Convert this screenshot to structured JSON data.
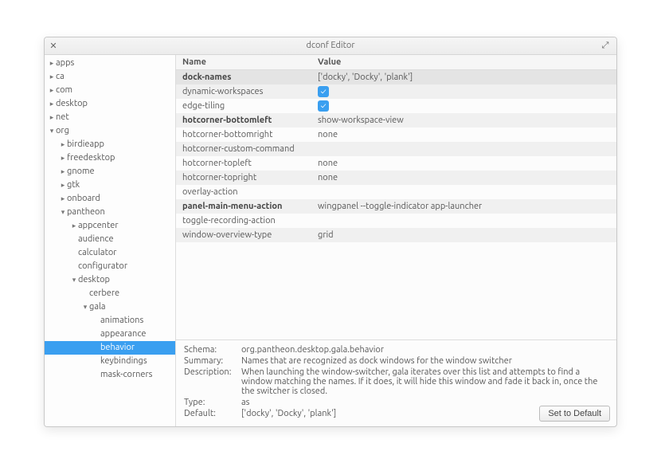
{
  "window": {
    "title": "dconf Editor"
  },
  "tree": [
    {
      "label": "apps",
      "depth": 0,
      "arrow": "right"
    },
    {
      "label": "ca",
      "depth": 0,
      "arrow": "right"
    },
    {
      "label": "com",
      "depth": 0,
      "arrow": "right"
    },
    {
      "label": "desktop",
      "depth": 0,
      "arrow": "right"
    },
    {
      "label": "net",
      "depth": 0,
      "arrow": "right"
    },
    {
      "label": "org",
      "depth": 0,
      "arrow": "down"
    },
    {
      "label": "birdieapp",
      "depth": 1,
      "arrow": "right"
    },
    {
      "label": "freedesktop",
      "depth": 1,
      "arrow": "right"
    },
    {
      "label": "gnome",
      "depth": 1,
      "arrow": "right"
    },
    {
      "label": "gtk",
      "depth": 1,
      "arrow": "right"
    },
    {
      "label": "onboard",
      "depth": 1,
      "arrow": "right"
    },
    {
      "label": "pantheon",
      "depth": 1,
      "arrow": "down"
    },
    {
      "label": "appcenter",
      "depth": 2,
      "arrow": "right"
    },
    {
      "label": "audience",
      "depth": 2,
      "arrow": ""
    },
    {
      "label": "calculator",
      "depth": 2,
      "arrow": ""
    },
    {
      "label": "configurator",
      "depth": 2,
      "arrow": ""
    },
    {
      "label": "desktop",
      "depth": 2,
      "arrow": "down"
    },
    {
      "label": "cerbere",
      "depth": 3,
      "arrow": ""
    },
    {
      "label": "gala",
      "depth": 3,
      "arrow": "down"
    },
    {
      "label": "animations",
      "depth": 4,
      "arrow": ""
    },
    {
      "label": "appearance",
      "depth": 4,
      "arrow": ""
    },
    {
      "label": "behavior",
      "depth": 4,
      "arrow": "",
      "selected": true
    },
    {
      "label": "keybindings",
      "depth": 4,
      "arrow": ""
    },
    {
      "label": "mask-corners",
      "depth": 4,
      "arrow": ""
    }
  ],
  "columns": {
    "name": "Name",
    "value": "Value"
  },
  "rows": [
    {
      "name": "dock-names",
      "bold": true,
      "valueType": "text",
      "value": "['docky', 'Docky', 'plank']",
      "selected": true
    },
    {
      "name": "dynamic-workspaces",
      "valueType": "check"
    },
    {
      "name": "edge-tiling",
      "valueType": "check"
    },
    {
      "name": "hotcorner-bottomleft",
      "bold": true,
      "valueType": "text",
      "value": "show-workspace-view"
    },
    {
      "name": "hotcorner-bottomright",
      "valueType": "text",
      "value": "none"
    },
    {
      "name": "hotcorner-custom-command",
      "valueType": "text",
      "value": ""
    },
    {
      "name": "hotcorner-topleft",
      "valueType": "text",
      "value": "none"
    },
    {
      "name": "hotcorner-topright",
      "valueType": "text",
      "value": "none"
    },
    {
      "name": "overlay-action",
      "valueType": "text",
      "value": ""
    },
    {
      "name": "panel-main-menu-action",
      "bold": true,
      "valueType": "text",
      "value": "wingpanel --toggle-indicator app-launcher"
    },
    {
      "name": "toggle-recording-action",
      "valueType": "text",
      "value": ""
    },
    {
      "name": "window-overview-type",
      "valueType": "text",
      "value": "grid"
    }
  ],
  "details": {
    "schemaLabel": "Schema:",
    "schema": "org.pantheon.desktop.gala.behavior",
    "summaryLabel": "Summary:",
    "summary": "Names that are recognized as dock windows for the window switcher",
    "descriptionLabel": "Description:",
    "description": "When launching the window-switcher, gala iterates over this list and attempts to find a window matching the names. If it does, it will hide this window and fade it back in, once the the switcher is closed.",
    "typeLabel": "Type:",
    "type": "as",
    "defaultLabel": "Default:",
    "default": "['docky', 'Docky', 'plank']",
    "button": "Set to Default"
  }
}
